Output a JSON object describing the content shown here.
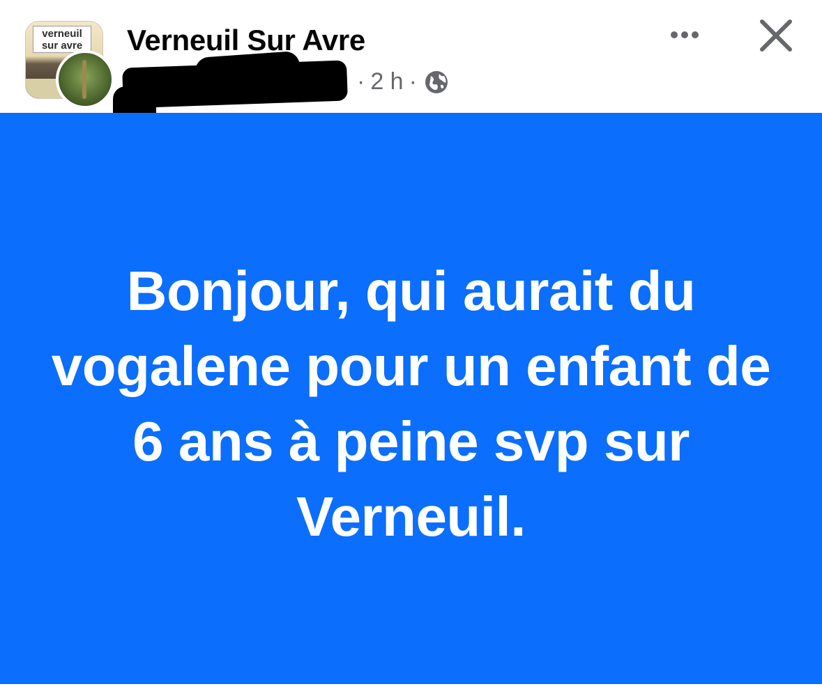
{
  "header": {
    "group_name": "Verneuil Sur Avre",
    "group_avatar_text": "verneuil sur avre",
    "time": "2 h",
    "separator": "·",
    "audience_icon": "globe-icon",
    "more_icon": "more-horizontal-icon",
    "close_icon": "close-icon"
  },
  "post": {
    "text": "Bonjour, qui aurait du vogalene pour un enfant de 6 ans à peine svp sur Verneuil.",
    "background_color": "#0b6efd",
    "text_color": "#ffffff"
  },
  "colors": {
    "title": "#050505",
    "meta": "#65676b"
  }
}
